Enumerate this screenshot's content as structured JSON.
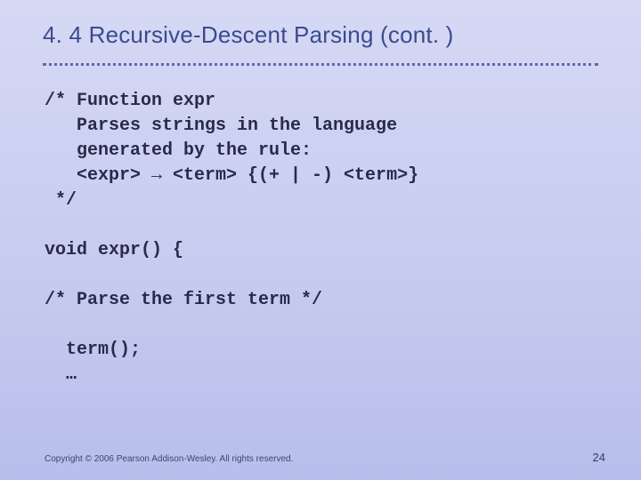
{
  "title": "4. 4 Recursive-Descent Parsing (cont. )",
  "code": "/* Function expr\n   Parses strings in the language\n   generated by the rule:\n   <expr> → <term> {(+ | -) <term>}\n */\n\nvoid expr() {\n\n/* Parse the first term */\n\n  term();\n  …",
  "footer": {
    "copyright": "Copyright © 2006 Pearson Addison-Wesley. All rights reserved.",
    "page": "24"
  }
}
